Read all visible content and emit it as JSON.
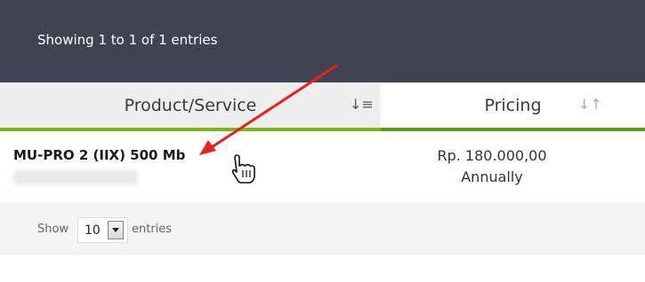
{
  "table_info": {
    "text": "Showing 1 to 1 of 1 entries"
  },
  "columns": [
    {
      "label": "Product/Service",
      "sort_icon": "sort-amount-down-icon"
    },
    {
      "label": "Pricing",
      "sort_icon": "sort-arrows-icon"
    }
  ],
  "rows": [
    {
      "product": "MU-PRO 2 (IIX) 500 Mb",
      "domain_blurred": true,
      "price": "Rp. 180.000,00",
      "billing_cycle": "Annually"
    }
  ],
  "length_menu": {
    "show_label": "Show",
    "value": "10",
    "entries_label": "entries"
  },
  "colors": {
    "info_bar": "#404452",
    "accent_green": "#7ab51d",
    "annotation_arrow": "#e8211c"
  },
  "annotations": {
    "arrow": "red-annotation-arrow",
    "cursor": "hand-pointer-cursor-icon"
  }
}
